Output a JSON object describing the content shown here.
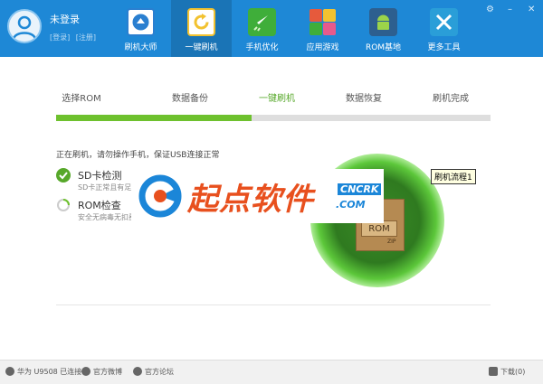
{
  "user": {
    "name": "未登录",
    "login": "[登录]",
    "register": "[注册]"
  },
  "nav": [
    {
      "label": "刷机大师",
      "icon": "home-icon",
      "color": "#2a7fd0"
    },
    {
      "label": "一键刷机",
      "icon": "refresh-icon",
      "color": "#f2c230"
    },
    {
      "label": "手机优化",
      "icon": "rocket-icon",
      "color": "#3fae3a"
    },
    {
      "label": "应用游戏",
      "icon": "apps-icon",
      "color": "#e65a3c"
    },
    {
      "label": "ROM基地",
      "icon": "android-icon",
      "color": "#3d8fd8"
    },
    {
      "label": "更多工具",
      "icon": "tools-icon",
      "color": "#2a9ed8"
    }
  ],
  "window_controls": {
    "settings": "⚙",
    "minimize": "–",
    "close": "✕"
  },
  "steps": [
    "选择ROM",
    "数据备份",
    "一键刷机",
    "数据恢复",
    "刷机完成"
  ],
  "current_step": 2,
  "progress": 0.45,
  "status_text": "正在刷机，请勿操作手机，保证USB连接正常",
  "checks": [
    {
      "title": "SD卡检测",
      "desc": "SD卡正常且有足",
      "state": "done"
    },
    {
      "title": "ROM检查",
      "desc": "安全无病毒无扣费",
      "state": "loading"
    }
  ],
  "rom_graphic": {
    "label": "ROM",
    "sub": "ZIP"
  },
  "tooltip": "刷机流程1",
  "watermark": {
    "text": "起点软件",
    "en1": "CNCRK",
    "en2": ".COM"
  },
  "footer": {
    "device": "华为 U9508 已连接",
    "weibo": "官方微博",
    "forum": "官方论坛",
    "download": "下载(0)"
  }
}
